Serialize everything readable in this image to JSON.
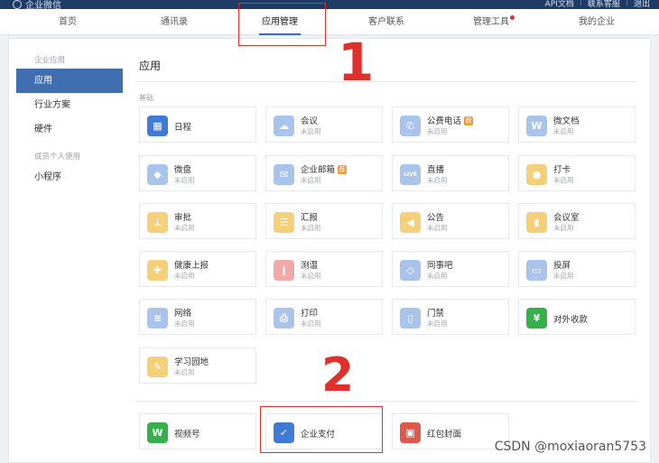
{
  "topbar": {
    "brand": "企业微信",
    "links": [
      "API文档",
      "联系客服",
      "退出"
    ]
  },
  "nav": {
    "tabs": [
      {
        "label": "首页",
        "active": false
      },
      {
        "label": "通讯录",
        "active": false
      },
      {
        "label": "应用管理",
        "active": true
      },
      {
        "label": "客户联系",
        "active": false
      },
      {
        "label": "管理工具",
        "active": false,
        "dot": true
      },
      {
        "label": "我的企业",
        "active": false
      }
    ]
  },
  "sidebar": {
    "groups": [
      {
        "title": "企业应用",
        "items": [
          {
            "label": "应用",
            "active": true
          },
          {
            "label": "行业方案",
            "active": false
          },
          {
            "label": "硬件",
            "active": false
          }
        ]
      },
      {
        "title": "成员个人使用",
        "items": [
          {
            "label": "小程序",
            "active": false
          }
        ]
      }
    ]
  },
  "main": {
    "title": "应用",
    "section_label": "基础",
    "status_text": "未启用",
    "apps": [
      {
        "name": "日程",
        "icon": "calendar-icon",
        "color": "#3f7ad9",
        "status": ""
      },
      {
        "name": "会议",
        "icon": "cloud-icon",
        "color": "#a9c4ec",
        "status": "未启用"
      },
      {
        "name": "公费电话",
        "icon": "phone-icon",
        "color": "#a9c4ec",
        "status": "未启用",
        "badge": "荐"
      },
      {
        "name": "微文档",
        "icon": "doc-w-icon",
        "color": "#a9c4ec",
        "status": "未启用"
      },
      {
        "name": "微盘",
        "icon": "drive-icon",
        "color": "#a9c4ec",
        "status": "未启用"
      },
      {
        "name": "企业邮箱",
        "icon": "mail-icon",
        "color": "#a9c4ec",
        "status": "未启用",
        "badge": "荐"
      },
      {
        "name": "直播",
        "icon": "live-icon",
        "color": "#a9c4ec",
        "status": "未启用"
      },
      {
        "name": "打卡",
        "icon": "location-pin-icon",
        "color": "#f5cf7a",
        "status": "未启用"
      },
      {
        "name": "审批",
        "icon": "stamp-icon",
        "color": "#f5cf7a",
        "status": "未启用"
      },
      {
        "name": "汇报",
        "icon": "report-icon",
        "color": "#f5cf7a",
        "status": "未启用"
      },
      {
        "name": "公告",
        "icon": "megaphone-icon",
        "color": "#f5cf7a",
        "status": "未启用"
      },
      {
        "name": "会议室",
        "icon": "door-icon",
        "color": "#f5cf7a",
        "status": "未启用"
      },
      {
        "name": "健康上报",
        "icon": "health-icon",
        "color": "#f5cf7a",
        "status": "未启用"
      },
      {
        "name": "测温",
        "icon": "thermometer-icon",
        "color": "#f1a9a9",
        "status": "未启用"
      },
      {
        "name": "同事吧",
        "icon": "diamond-icon",
        "color": "#a9c4ec",
        "status": "未启用"
      },
      {
        "name": "投屏",
        "icon": "screen-cast-icon",
        "color": "#a9c4ec",
        "status": "未启用"
      },
      {
        "name": "网络",
        "icon": "wifi-icon",
        "color": "#a9c4ec",
        "status": "未启用"
      },
      {
        "name": "打印",
        "icon": "printer-icon",
        "color": "#a9c4ec",
        "status": "未启用"
      },
      {
        "name": "门禁",
        "icon": "gate-icon",
        "color": "#a9c4ec",
        "status": "未启用"
      },
      {
        "name": "对外收款",
        "icon": "yuan-icon",
        "color": "#35b04a",
        "status": ""
      },
      {
        "name": "学习园地",
        "icon": "learning-icon",
        "color": "#f5cf7a",
        "status": "未启用"
      }
    ],
    "bottom_apps": [
      {
        "name": "视频号",
        "icon": "channels-icon",
        "color": "#35b04a"
      },
      {
        "name": "企业支付",
        "icon": "pay-icon",
        "color": "#3f7ad9"
      },
      {
        "name": "红包封面",
        "icon": "red-packet-icon",
        "color": "#e0584c"
      }
    ]
  },
  "annotations": {
    "label_1": "1",
    "label_2": "2"
  },
  "watermark": "CSDN @moxiaoran5753"
}
